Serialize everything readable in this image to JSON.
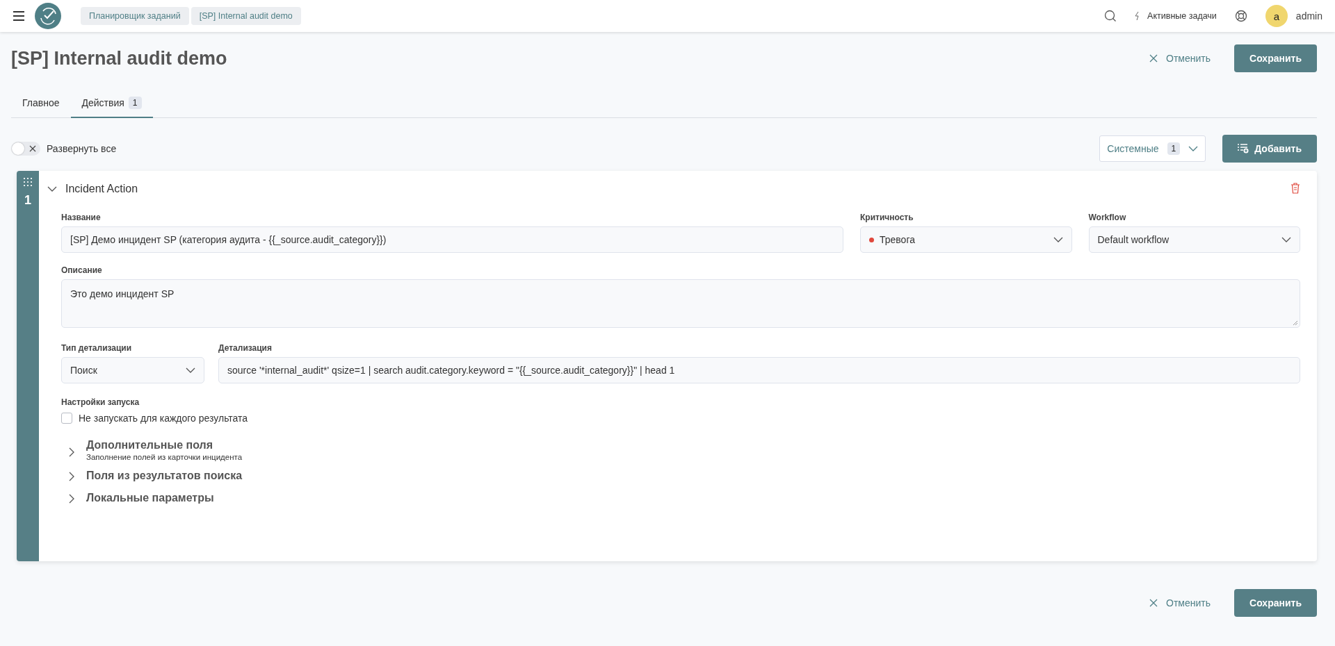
{
  "topbar": {
    "breadcrumbs": [
      "Планировщик заданий",
      "[SP] Internal audit demo"
    ],
    "active_tasks": "Активные задачи",
    "avatar_letter": "a",
    "user_name": "admin"
  },
  "page": {
    "title": "[SP] Internal audit demo",
    "cancel": "Отменить",
    "save": "Сохранить"
  },
  "tabs": [
    {
      "label": "Главное",
      "selected": false
    },
    {
      "label": "Действия",
      "badge": "1",
      "selected": true
    }
  ],
  "toolbar": {
    "expand_all": {
      "label": "Развернуть все",
      "on": false
    },
    "filter": {
      "label": "Системные",
      "count": "1"
    },
    "add": "Добавить"
  },
  "action": {
    "index": "1",
    "title": "Incident Action",
    "expanded": true,
    "name": {
      "label": "Название",
      "value": "[SP] Демо инцидент SP (категория аудита - {{_source.audit_category}})"
    },
    "severity": {
      "label": "Критичность",
      "value": "Тревога"
    },
    "workflow": {
      "label": "Workflow",
      "value": "Default workflow"
    },
    "description": {
      "label": "Описание",
      "value": "Это демо инцидент SP"
    },
    "detail_type": {
      "label": "Тип детализации",
      "value": "Поиск"
    },
    "detail": {
      "label": "Детализация",
      "value": "source '*internal_audit*' qsize=1 | search audit.category.keyword = \"{{_source.audit_category}}\" | head 1"
    },
    "run_settings": {
      "label": "Настройки запуска",
      "checkbox": {
        "label": "Не запускать для каждого результата",
        "checked": false
      }
    },
    "sections": [
      {
        "title": "Дополнительные поля",
        "subtitle": "Заполнение полей из карточки инцидента",
        "expanded": false
      },
      {
        "title": "Поля из результатов поиска",
        "expanded": false
      },
      {
        "title": "Локальные параметры",
        "expanded": false
      }
    ]
  },
  "footer": {
    "cancel": "Отменить",
    "save": "Сохранить"
  }
}
